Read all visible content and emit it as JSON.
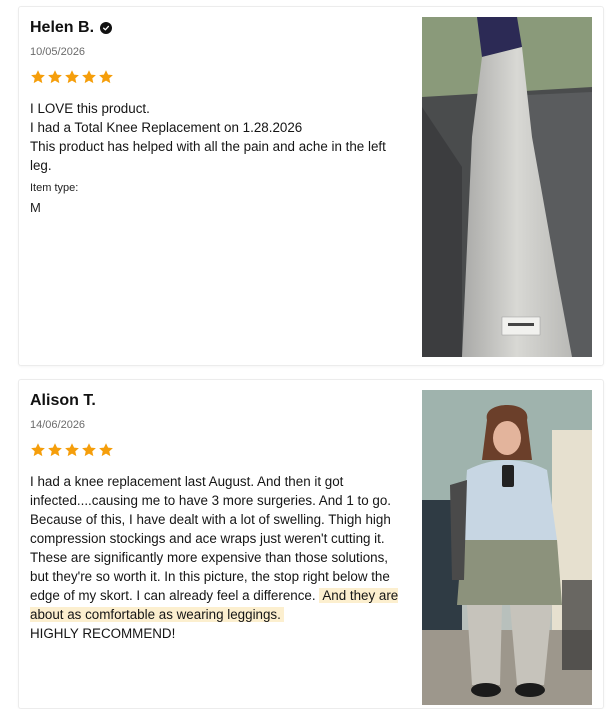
{
  "reviews": [
    {
      "author": "Helen B.",
      "date": "10/05/2026",
      "rating": 5,
      "body_lines": [
        "I LOVE  this product.",
        "I had a Total Knee Replacement on 1.28.2026",
        "This product has helped with all the pain and ache in the left leg."
      ],
      "item_type_label": "Item type:",
      "item_type_value": "M"
    },
    {
      "author": "Alison T.",
      "date": "14/06/2026",
      "rating": 5,
      "body_lines": [
        "I had a knee replacement last August. And then it got infected....causing me to have 3 more surgeries. And 1 to go.",
        "Because of this, I have dealt with a lot of swelling. Thigh high compression stockings and ace wraps just weren't cutting it.",
        "These are significantly more expensive than those solutions, but they're so worth it. In this picture, the stop right below the edge of my skort. I can already feel a difference.",
        "And they are about as comfortable as wearing leggings.",
        "HIGHLY RECOMMEND!"
      ]
    }
  ],
  "colors": {
    "star": "#f59e0b",
    "highlight": "#fcefcf"
  },
  "icons": {
    "verified": "verified-check-icon",
    "star": "star-icon"
  }
}
